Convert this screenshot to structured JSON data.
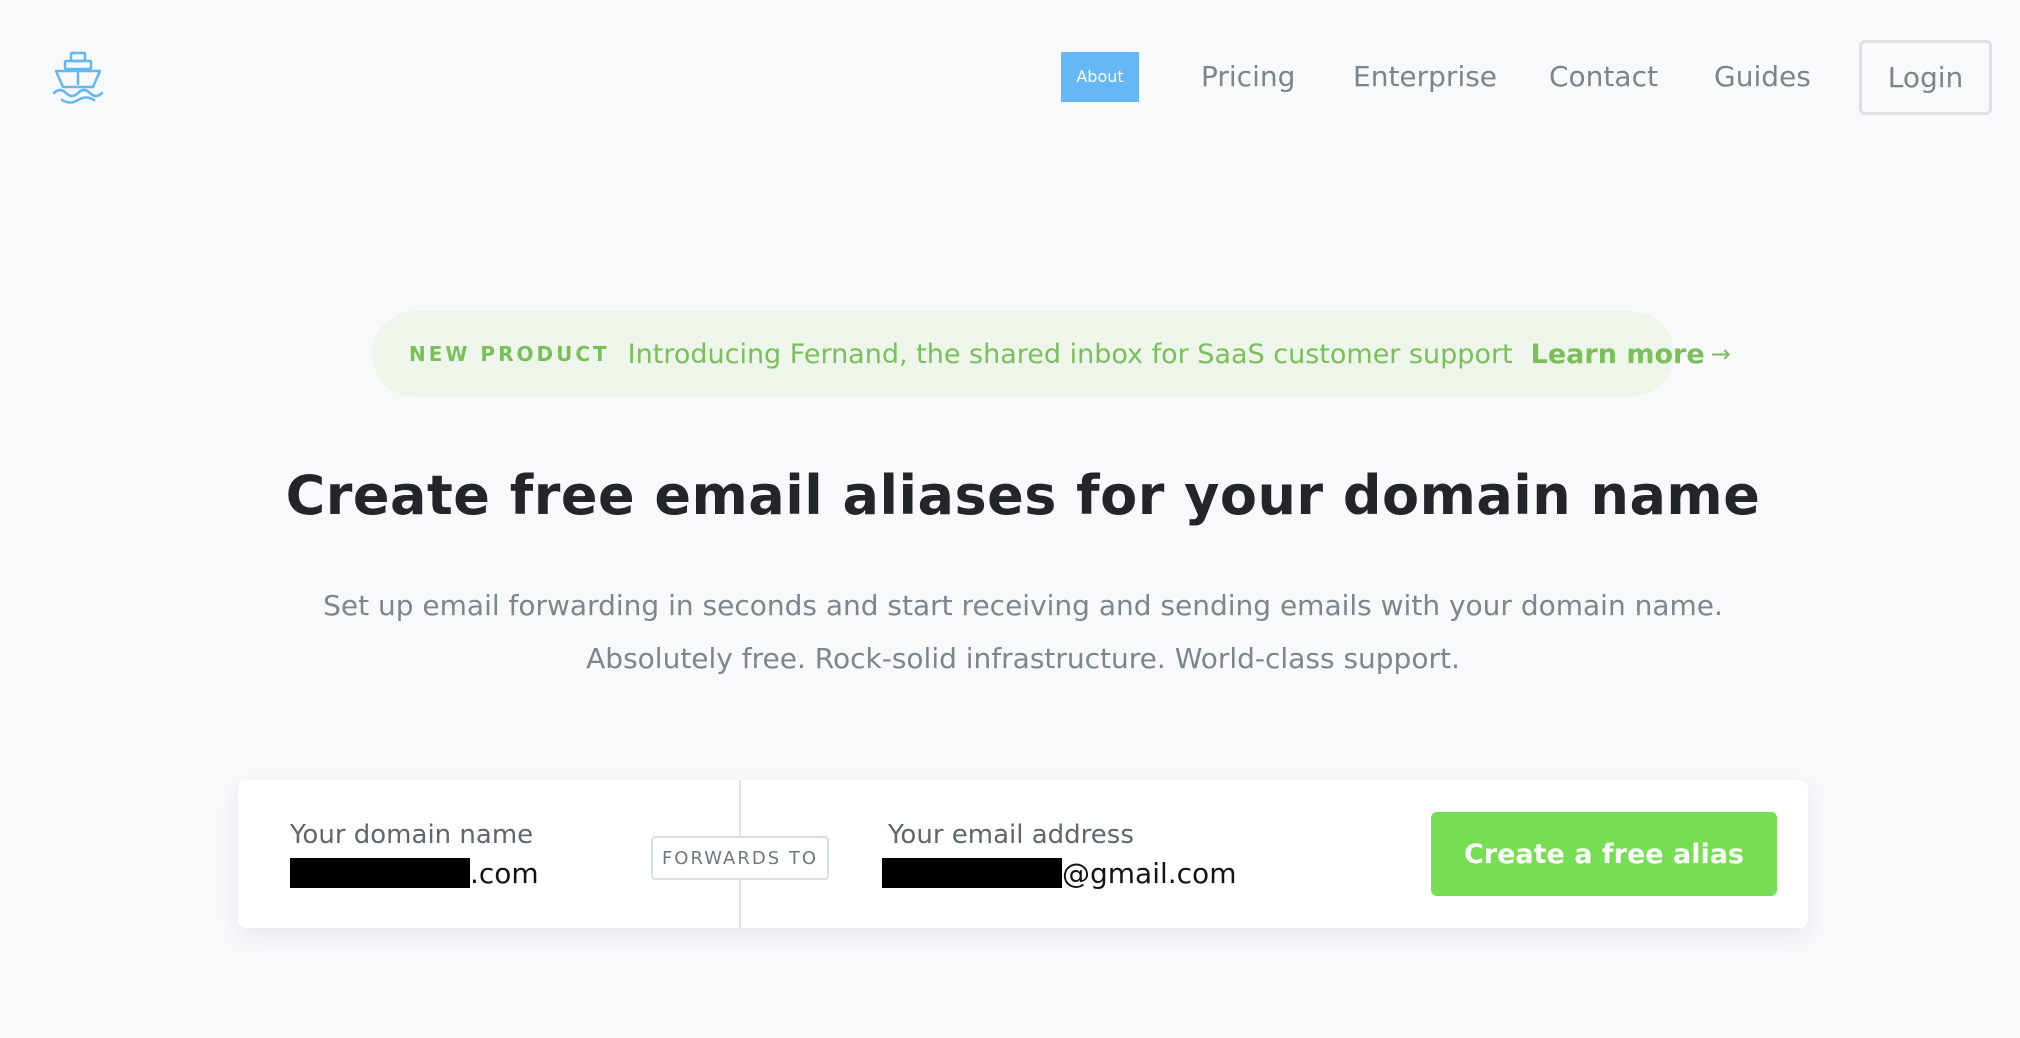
{
  "header": {
    "logo_icon": "ship-icon",
    "nav": [
      {
        "label": "About",
        "selected": true
      },
      {
        "label": "Pricing",
        "selected": false
      },
      {
        "label": "Enterprise",
        "selected": false
      },
      {
        "label": "Contact",
        "selected": false
      },
      {
        "label": "Guides",
        "selected": false
      }
    ],
    "login_label": "Login"
  },
  "banner": {
    "tag": "NEW PRODUCT",
    "text": "Introducing Fernand, the shared inbox for SaaS customer support",
    "link_label": "Learn more",
    "arrow": "→"
  },
  "hero": {
    "title": "Create free email aliases for your domain name",
    "subtitle_line1": "Set up email forwarding in seconds and start receiving and sending emails with your domain name.",
    "subtitle_line2": "Absolutely free. Rock-solid infrastructure. World-class support."
  },
  "form": {
    "domain_label": "Your domain name",
    "domain_suffix": ".com",
    "forwards_label": "FORWARDS TO",
    "email_label": "Your email address",
    "email_suffix": "@gmail.com",
    "cta_label": "Create a free alias"
  },
  "colors": {
    "accent_blue": "#65b7f5",
    "accent_green": "#76de52",
    "banner_green": "#7ac05a",
    "background": "#f7f9fb"
  }
}
